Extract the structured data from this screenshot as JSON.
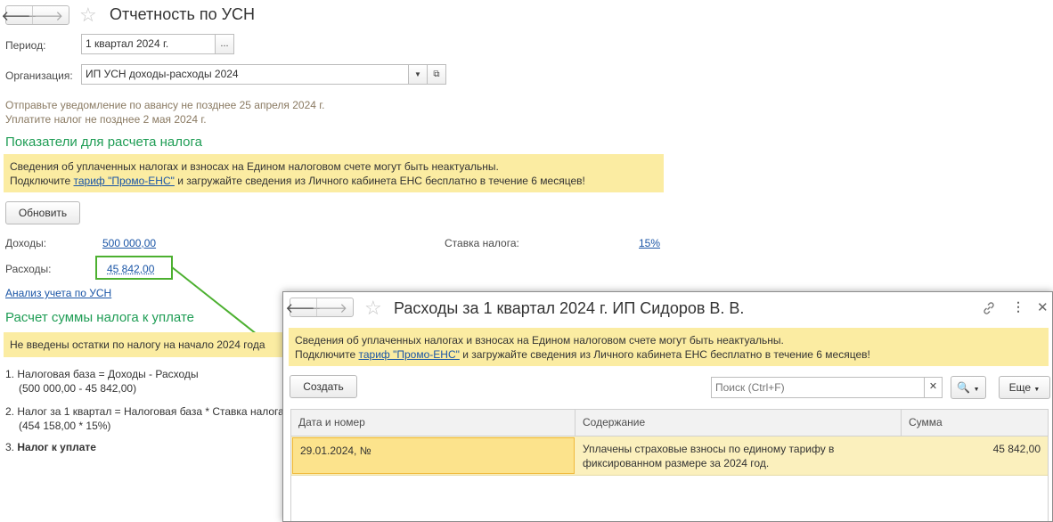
{
  "main": {
    "title": "Отчетность по УСН",
    "period_label": "Период:",
    "period_value": "1 квартал 2024 г.",
    "period_btn": "...",
    "org_label": "Организация:",
    "org_value": "ИП УСН доходы-расходы 2024",
    "notice_line1": "Отправьте уведомление по авансу не позднее 25 апреля 2024 г.",
    "notice_line2": "Уплатите налог не позднее 2 мая 2024 г.",
    "section1_title": "Показатели для расчета налога",
    "warn_line1": "Сведения об уплаченных налогах и взносах на Едином налоговом счете могут быть неактуальны.",
    "warn_prefix": "Подключите",
    "warn_link": "тариф \"Промо-ЕНС\"",
    "warn_suffix": "и загружайте сведения из Личного кабинета ЕНС бесплатно в течение 6 месяцев!",
    "refresh_btn": "Обновить",
    "income_label": "Доходы:",
    "income_value": "500 000,00",
    "rate_label": "Ставка налога:",
    "rate_value": "15%",
    "expense_label": "Расходы:",
    "expense_value": "45 842,00",
    "analysis_link": "Анализ учета по УСН",
    "section2_title": "Расчет суммы налога к уплате",
    "warn2": "Не введены остатки по налогу на начало 2024 года",
    "item1": "1. Налоговая база = Доходы - Расходы",
    "item1_calc": "(500 000,00 - 45 842,00)",
    "item2": "2. Налог за 1 квартал = Налоговая база * Ставка налога",
    "item2_calc": "(454 158,00 * 15%)",
    "item3_num": "3.",
    "item3_text": "Налог к уплате"
  },
  "popup": {
    "title": "Расходы за 1 квартал 2024 г. ИП Сидоров В. В.",
    "warn_line1": "Сведения об уплаченных налогах и взносах на Едином налоговом счете могут быть неактуальны.",
    "warn_prefix": "Подключите",
    "warn_link": "тариф \"Промо-ЕНС\"",
    "warn_suffix": "и загружайте сведения из Личного кабинета ЕНС бесплатно в течение 6 месяцев!",
    "create_btn": "Создать",
    "search_placeholder": "Поиск (Ctrl+F)",
    "more_btn": "Еще",
    "columns": [
      "Дата и номер",
      "Содержание",
      "Сумма"
    ],
    "rows": [
      {
        "date": "29.01.2024, №",
        "content_line1": "Уплачены страховые взносы по единому тарифу в",
        "content_line2": "фиксированном размере за 2024 год.",
        "sum": "45 842,00"
      }
    ]
  },
  "icons": {
    "back": "arrow-left-icon",
    "forward": "arrow-right-icon",
    "favorite": "star-icon",
    "open": "open-icon",
    "dropdown": "chevron-down-icon",
    "link": "link-icon",
    "menu": "more-vertical-icon",
    "close": "close-icon",
    "search": "search-icon"
  },
  "colors": {
    "section": "#1f9d55",
    "warning_bg": "#fbeca2",
    "link": "#1a55a6",
    "highlight": "#4cb030",
    "selected_row": "#fbf0bd"
  }
}
